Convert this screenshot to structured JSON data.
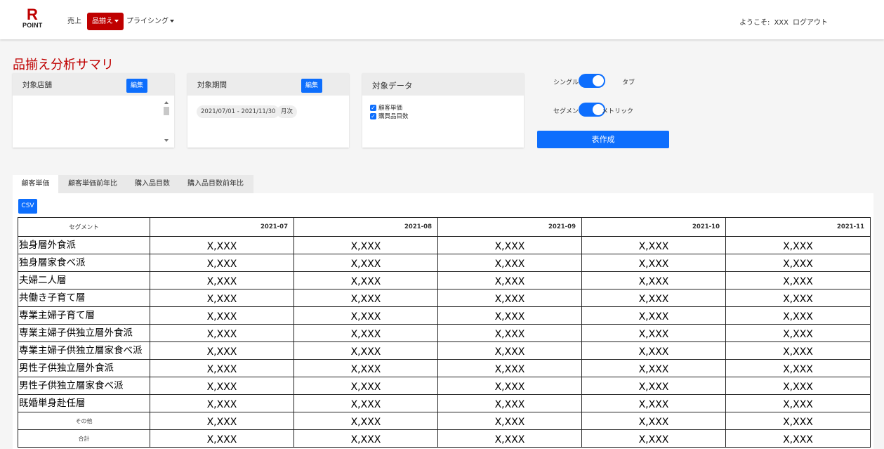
{
  "header": {
    "logo_mark": "R",
    "logo_text": "POINT",
    "nav": [
      {
        "label": "売上"
      },
      {
        "label": "品揃え"
      },
      {
        "label": "プライシング"
      }
    ],
    "welcome": "ようこそ:",
    "user": "XXX",
    "logout": "ログアウト"
  },
  "page_title": "品揃え分析サマリ",
  "store_card": {
    "title": "対象店舗",
    "edit_label": "編集"
  },
  "period_card": {
    "title": "対象期間",
    "edit_label": "編集",
    "range": "2021/07/01 - 2021/11/30",
    "granularity": "月次"
  },
  "data_card": {
    "title": "対象データ",
    "items": [
      "顧客単価",
      "購買品目数"
    ]
  },
  "toggles": {
    "t1_left": "シングル",
    "t1_right": "タブ",
    "t2_left": "セグメン",
    "t2_right": "メトリック"
  },
  "create_button": "表作成",
  "tabs": [
    "顧客単価",
    "顧客単価前年比",
    "購入品目数",
    "購入品目数前年比"
  ],
  "csv_label": "CSV",
  "table": {
    "segment_header": "セグメント",
    "months": [
      "2021-07",
      "2021-08",
      "2021-09",
      "2021-10",
      "2021-11"
    ],
    "rows": [
      {
        "segment": "独身層外食派",
        "values": [
          "X,XXX",
          "X,XXX",
          "X,XXX",
          "X,XXX",
          "X,XXX"
        ]
      },
      {
        "segment": "独身層家食べ派",
        "values": [
          "X,XXX",
          "X,XXX",
          "X,XXX",
          "X,XXX",
          "X,XXX"
        ]
      },
      {
        "segment": "夫婦二人層",
        "values": [
          "X,XXX",
          "X,XXX",
          "X,XXX",
          "X,XXX",
          "X,XXX"
        ]
      },
      {
        "segment": "共働き子育て層",
        "values": [
          "X,XXX",
          "X,XXX",
          "X,XXX",
          "X,XXX",
          "X,XXX"
        ]
      },
      {
        "segment": "専業主婦子育て層",
        "values": [
          "X,XXX",
          "X,XXX",
          "X,XXX",
          "X,XXX",
          "X,XXX"
        ]
      },
      {
        "segment": "専業主婦子供独立層外食派",
        "values": [
          "X,XXX",
          "X,XXX",
          "X,XXX",
          "X,XXX",
          "X,XXX"
        ]
      },
      {
        "segment": "専業主婦子供独立層家食べ派",
        "values": [
          "X,XXX",
          "X,XXX",
          "X,XXX",
          "X,XXX",
          "X,XXX"
        ]
      },
      {
        "segment": "男性子供独立層外食派",
        "values": [
          "X,XXX",
          "X,XXX",
          "X,XXX",
          "X,XXX",
          "X,XXX"
        ]
      },
      {
        "segment": "男性子供独立層家食べ派",
        "values": [
          "X,XXX",
          "X,XXX",
          "X,XXX",
          "X,XXX",
          "X,XXX"
        ]
      },
      {
        "segment": "既婚単身赴任層",
        "values": [
          "X,XXX",
          "X,XXX",
          "X,XXX",
          "X,XXX",
          "X,XXX"
        ]
      },
      {
        "segment": "その他",
        "values": [
          "X,XXX",
          "X,XXX",
          "X,XXX",
          "X,XXX",
          "X,XXX"
        ]
      },
      {
        "segment": "合計",
        "values": [
          "X,XXX",
          "X,XXX",
          "X,XXX",
          "X,XXX",
          "X,XXX"
        ]
      }
    ]
  },
  "colors": {
    "brand_red": "#bf0000",
    "primary_blue": "#0d6efd"
  }
}
